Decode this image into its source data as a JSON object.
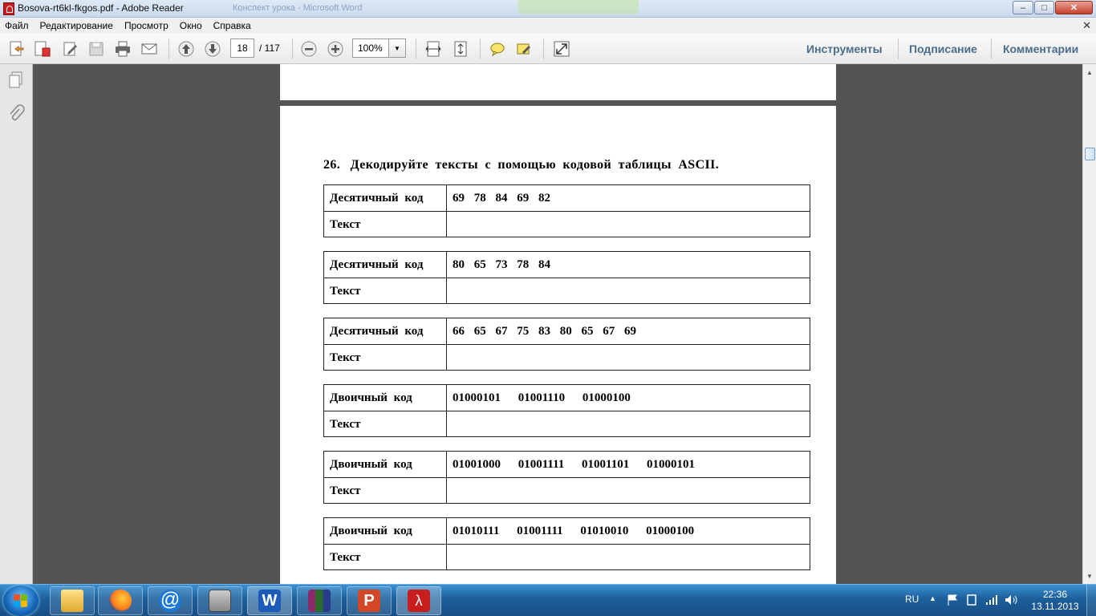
{
  "window": {
    "title": "Bosova-rt6kl-fkgos.pdf - Adobe Reader",
    "ghost_title": "Конспект урока - Microsoft Word"
  },
  "menu": [
    "Файл",
    "Редактирование",
    "Просмотр",
    "Окно",
    "Справка"
  ],
  "toolbar": {
    "page_current": "18",
    "page_total": "/ 117",
    "zoom": "100%"
  },
  "right_panel_links": {
    "tools": "Инструменты",
    "sign": "Подписание",
    "comments": "Комментарии"
  },
  "document": {
    "task_number": "26.",
    "task_text": "Декодируйте тексты с помощью кодовой таблицы ASCII.",
    "tables": [
      {
        "label": "Десятичный код",
        "values": "69 78 84 69 82",
        "text_label": "Текст"
      },
      {
        "label": "Десятичный код",
        "values": "80 65 73 78 84",
        "text_label": "Текст"
      },
      {
        "label": "Десятичный код",
        "values": "66 65 67 75 83 80 65 67 69",
        "text_label": "Текст"
      },
      {
        "label": "Двоичный код",
        "values": "01000101 01001110 01000100",
        "text_label": "Текст"
      },
      {
        "label": "Двоичный код",
        "values": "01001000 01001111 01001101 01000101",
        "text_label": "Текст"
      },
      {
        "label": "Двоичный код",
        "values": "01010111 01001111 01010010 01000100",
        "text_label": "Текст"
      }
    ]
  },
  "taskbar": {
    "language": "RU",
    "time": "22:36",
    "date": "13.11.2013"
  }
}
